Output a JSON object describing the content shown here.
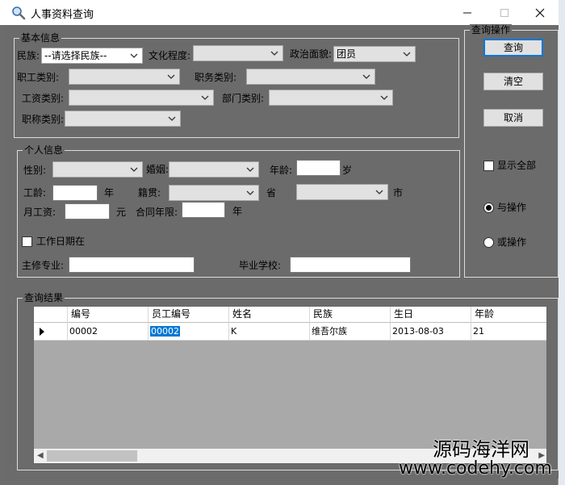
{
  "window": {
    "title": "人事资料查询"
  },
  "basic": {
    "legend": "基本信息",
    "ethnicity_label": "民族",
    "ethnicity_value": "--请选择民族--",
    "education_label": "文化程度",
    "education_value": "",
    "politics_label": "政治面貌",
    "politics_value": "团员",
    "staff_type_label": "职工类别",
    "job_type_label": "职务类别",
    "wage_type_label": "工资类别",
    "dept_type_label": "部门类别",
    "title_type_label": "职称类别"
  },
  "personal": {
    "legend": "个人信息",
    "gender_label": "性别",
    "marriage_label": "婚姻",
    "age_label": "年龄",
    "age_unit": "岁",
    "seniority_label": "工龄",
    "seniority_unit": "年",
    "native_label": "籍贯",
    "province_unit": "省",
    "city_unit": "市",
    "salary_label": "月工资",
    "salary_unit": "元",
    "contract_label": "合同年限",
    "contract_unit": "年",
    "work_date_label": "工作日期在",
    "major_label": "主修专业",
    "school_label": "毕业学校"
  },
  "ops": {
    "legend": "查询操作",
    "query_button": "查询",
    "clear_button": "清空",
    "cancel_button": "取消",
    "show_all_label": "显示全部",
    "and_label": "与操作",
    "or_label": "或操作"
  },
  "results": {
    "legend": "查询结果",
    "columns": [
      "编号",
      "员工编号",
      "姓名",
      "民族",
      "生日",
      "年龄"
    ],
    "rows": [
      [
        "00002",
        "00002",
        "K",
        "维吾尔族",
        "2013-08-03",
        "21"
      ]
    ]
  },
  "watermark": {
    "line1": "源码海洋网",
    "line2": "www.codehy.com"
  },
  "colors": {
    "form_bg": "#6b6b6b",
    "selection": "#0078d7",
    "grid_bg": "#a9a9a9"
  }
}
